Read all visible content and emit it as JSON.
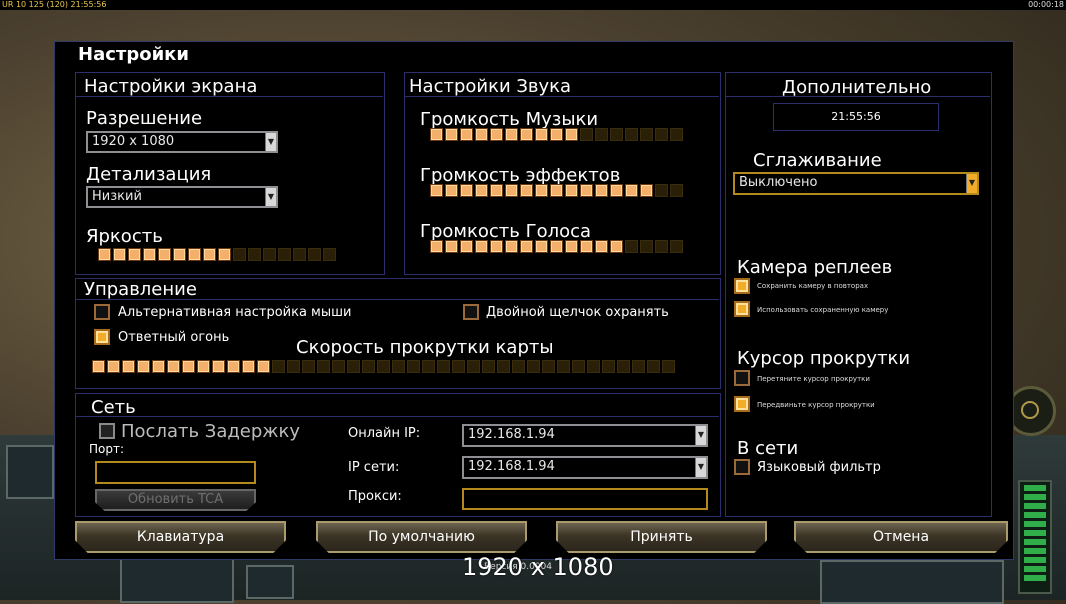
{
  "hud": {
    "left": "UR 10 125 (120) 21:55:56",
    "right": "00:00:18"
  },
  "dialog_title": "Настройки",
  "screen": {
    "title": "Настройки экрана",
    "resolution_label": "Разрешение",
    "resolution_value": "1920 x 1080",
    "detail_label": "Детализация",
    "detail_value": "Низкий",
    "brightness_label": "Яркость",
    "brightness_level": "9/16"
  },
  "sound": {
    "title": "Настройки Звука",
    "music_label": "Громкость Музыки",
    "music_level": "10/17",
    "effects_label": "Громкость эффектов",
    "effects_level": "15/17",
    "voice_label": "Громкость Голоса",
    "voice_level": "13/17"
  },
  "extra": {
    "title": "Дополнительно",
    "clock": "21:55:56",
    "aa_label": "Сглаживание",
    "aa_value": "Выключено",
    "replay_camera_label": "Камера реплеев",
    "replay_save": "Сохранить камеру в повторах",
    "replay_use": "Использовать сохраненную камеру",
    "cursor_label": "Курсор прокрутки",
    "cursor_drag": "Перетяните курсор прокрутки",
    "cursor_move": "Передвиньте курсор прокрутки",
    "online_label": "В сети",
    "lang_filter": "Языковый фильтр"
  },
  "control": {
    "title": "Управление",
    "alt_mouse": "Альтернативная настройка мыши",
    "double_click": "Двойной щелчок охранять",
    "return_fire": "Ответный огонь",
    "scroll_speed_label": "Скорость прокрутки карты",
    "scroll_level": "12/39"
  },
  "network": {
    "title": "Сеть",
    "send_delay": "Послать Задержку",
    "port_label": "Порт:",
    "update_tca": "Обновить TCA",
    "online_ip_label": "Онлайн IP:",
    "online_ip_value": "192.168.1.94",
    "lan_ip_label": "IP сети:",
    "lan_ip_value": "192.168.1.94",
    "proxy_label": "Прокси:"
  },
  "buttons": {
    "keyboard": "Клавиатура",
    "defaults": "По умолчанию",
    "accept": "Принять",
    "cancel": "Отмена"
  },
  "footer": {
    "resolution": "1920 x 1080",
    "version": "Версия 0.0004"
  },
  "colors": {
    "bar_on": "#f4b06a",
    "panel_border": "#2d2f6c",
    "accent_gold": "#b58a1c"
  }
}
